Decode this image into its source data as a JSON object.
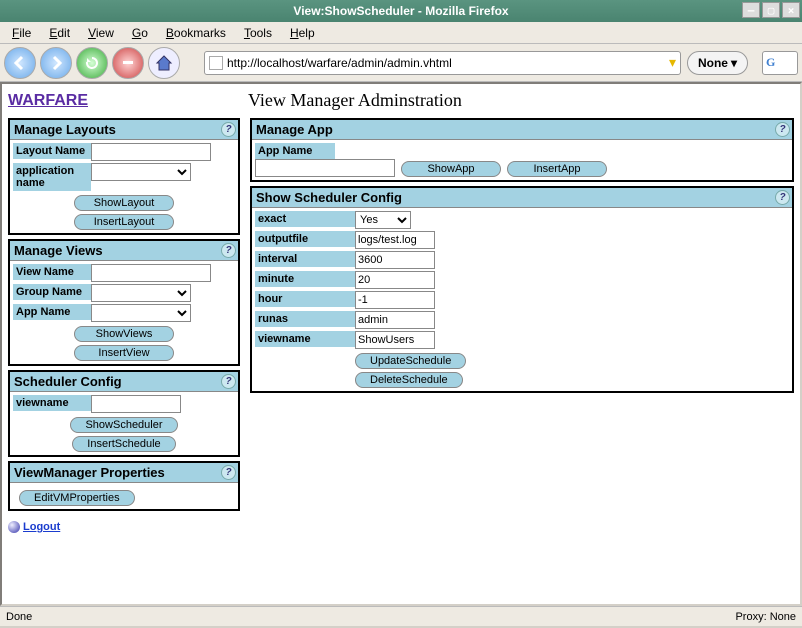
{
  "window": {
    "title": "View:ShowScheduler - Mozilla Firefox"
  },
  "menubar": {
    "file": "File",
    "edit": "Edit",
    "view": "View",
    "go": "Go",
    "bookmarks": "Bookmarks",
    "tools": "Tools",
    "help": "Help"
  },
  "toolbar": {
    "url": "http://localhost/warfare/admin/admin.vhtml",
    "none_label": "None",
    "search_hint": "G"
  },
  "page": {
    "brand": "WARFARE",
    "title": "View Manager Adminstration",
    "logout": "Logout"
  },
  "statusbar": {
    "left": "Done",
    "right": "Proxy: None"
  },
  "panels": {
    "manage_layouts": {
      "title": "Manage Layouts",
      "layout_name_label": "Layout Name",
      "app_name_label": "application name",
      "show_btn": "ShowLayout",
      "insert_btn": "InsertLayout"
    },
    "manage_views": {
      "title": "Manage Views",
      "view_name_label": "View Name",
      "group_name_label": "Group Name",
      "app_name_label": "App Name",
      "show_btn": "ShowViews",
      "insert_btn": "InsertView"
    },
    "scheduler_config": {
      "title": "Scheduler Config",
      "viewname_label": "viewname",
      "show_btn": "ShowScheduler",
      "insert_btn": "InsertSchedule"
    },
    "vm_props": {
      "title": "ViewManager Properties",
      "edit_btn": "EditVMProperties"
    },
    "manage_app": {
      "title": "Manage App",
      "app_name_label": "App Name",
      "show_btn": "ShowApp",
      "insert_btn": "InsertApp"
    },
    "show_scheduler": {
      "title": "Show Scheduler Config",
      "exact_label": "exact",
      "exact_value": "Yes",
      "outputfile_label": "outputfile",
      "outputfile_value": "logs/test.log",
      "interval_label": "interval",
      "interval_value": "3600",
      "minute_label": "minute",
      "minute_value": "20",
      "hour_label": "hour",
      "hour_value": "-1",
      "runas_label": "runas",
      "runas_value": "admin",
      "viewname_label": "viewname",
      "viewname_value": "ShowUsers",
      "update_btn": "UpdateSchedule",
      "delete_btn": "DeleteSchedule"
    }
  }
}
